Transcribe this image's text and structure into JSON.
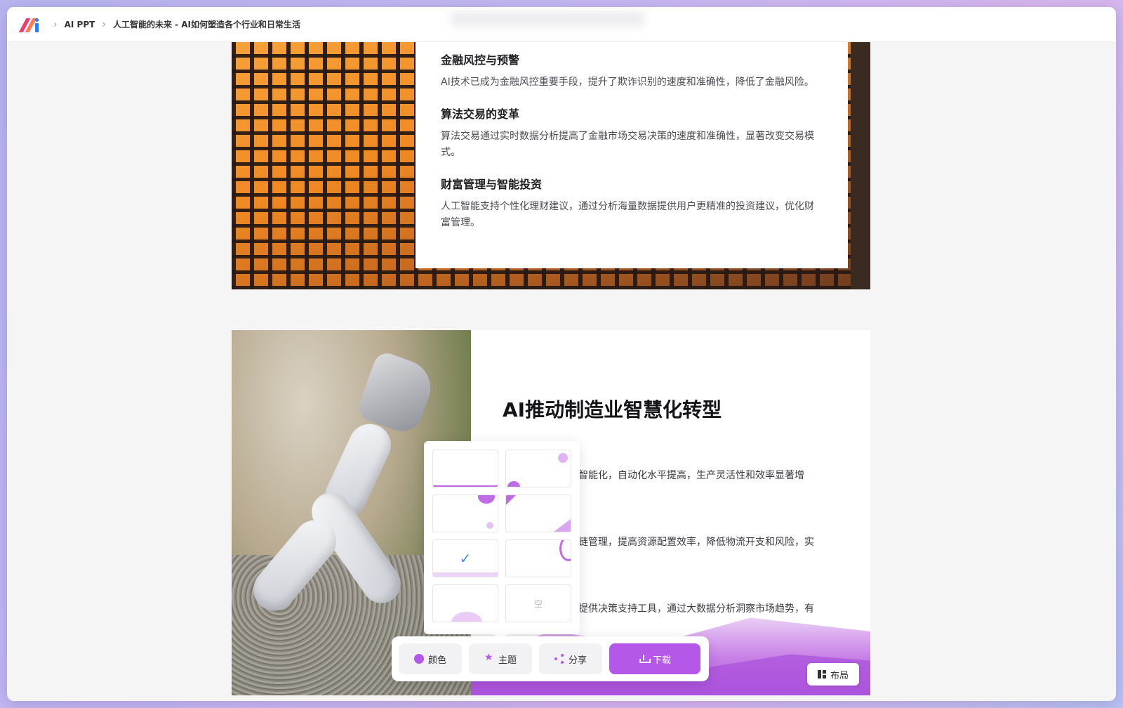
{
  "breadcrumb": {
    "app": "AI PPT",
    "doc_title": "人工智能的未来 - AI如何塑造各个行业和日常生活"
  },
  "slide1": {
    "items": [
      {
        "title": "金融风控与预警",
        "text": "AI技术已成为金融风控重要手段，提升了欺诈识别的速度和准确性，降低了金融风险。"
      },
      {
        "title": "算法交易的变革",
        "text": "算法交易通过实时数据分析提高了金融市场交易决策的速度和准确性，显著改变交易模式。"
      },
      {
        "title": "财富管理与智能投资",
        "text": "人工智能支持个性化理财建议，通过分析海量数据提供用户更精准的投资建议，优化财富管理。"
      }
    ]
  },
  "slide2": {
    "heading": "AI推动制造业智慧化转型",
    "lines": [
      "智能化，自动化水平提高，生产灵活性和效率显著增",
      "链管理，提高资源配置效率，降低物流开支和风险，实",
      "提供决策支持工具，通过大数据分析洞察市场趋势，有"
    ],
    "layout_label": "布局"
  },
  "theme_popup": {
    "empty_label": "空",
    "selected_index": 4
  },
  "toolbar": {
    "color_label": "颜色",
    "theme_label": "主题",
    "share_label": "分享",
    "download_label": "下载"
  },
  "colors": {
    "accent": "#b557e8",
    "check": "#3a8ee6"
  }
}
